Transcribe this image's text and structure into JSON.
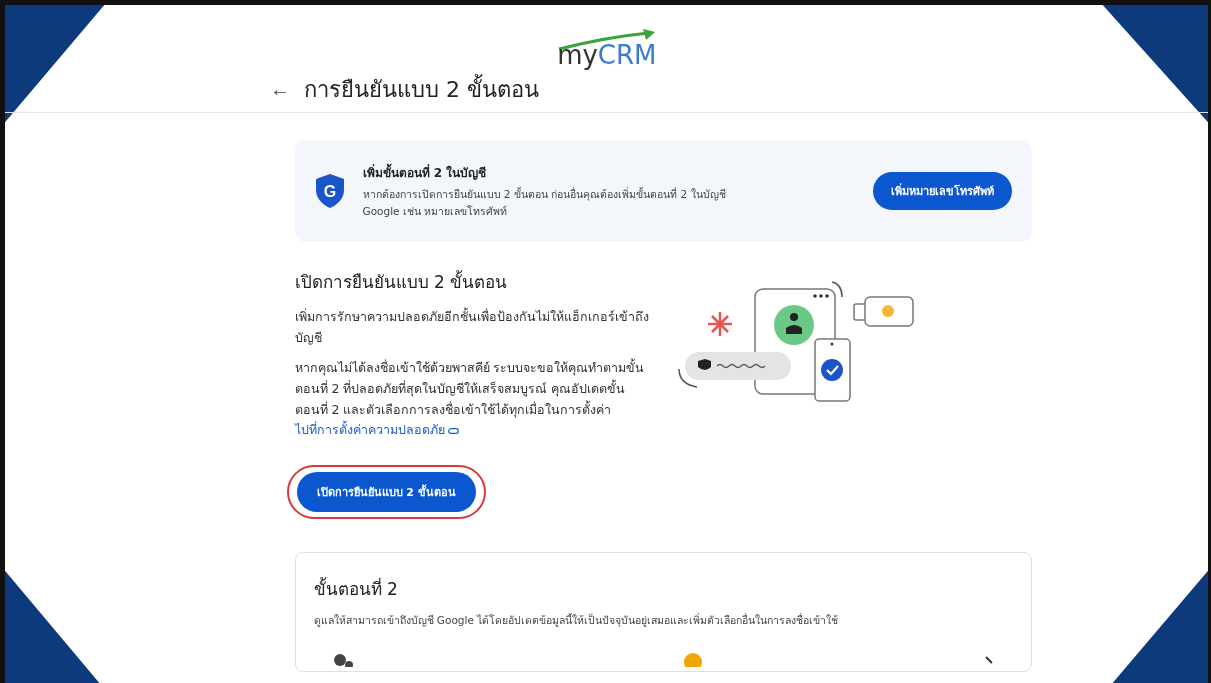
{
  "logo": {
    "text_dark": "my",
    "text_accent": "CRM"
  },
  "header": {
    "back": "←",
    "title": "การยืนยันแบบ 2 ขั้นตอน"
  },
  "banner": {
    "shield_letter": "G",
    "title": "เพิ่มขั้นตอนที่ 2 ในบัญชี",
    "text": "หากต้องการเปิดการยืนยันแบบ 2 ขั้นตอน ก่อนอื่นคุณต้องเพิ่มขั้นตอนที่ 2 ในบัญชี Google เช่น หมายเลขโทรศัพท์",
    "button": "เพิ่มหมายเลขโทรศัพท์"
  },
  "intro": {
    "title": "เปิดการยืนยันแบบ 2 ขั้นตอน",
    "paragraph_1": "เพิ่มการรักษาความปลอดภัยอีกชั้นเพื่อป้องกันไม่ให้แฮ็กเกอร์เข้าถึงบัญชี",
    "paragraph_2": "หากคุณไม่ได้ลงชื่อเข้าใช้ด้วยพาสคีย์ ระบบจะขอให้คุณทำตามขั้นตอนที่ 2 ที่ปลอดภัยที่สุดในบัญชีให้เสร็จสมบูรณ์ คุณอัปเดตขั้นตอนที่ 2 และตัวเลือกการลงชื่อเข้าใช้ได้ทุกเมื่อในการตั้งค่า",
    "link": "ไปที่การตั้งค่าความปลอดภัย",
    "button": "เปิดการยืนยันแบบ 2 ขั้นตอน",
    "button_highlighted": true
  },
  "second_step": {
    "title": "ขั้นตอนที่ 2",
    "text": "ดูแลให้สามารถเข้าถึงบัญชี Google ได้โดยอัปเดตข้อมูลนี้ให้เป็นปัจจุบันอยู่เสมอและเพิ่มตัวเลือกอื่นในการลงชื่อเข้าใช้"
  }
}
